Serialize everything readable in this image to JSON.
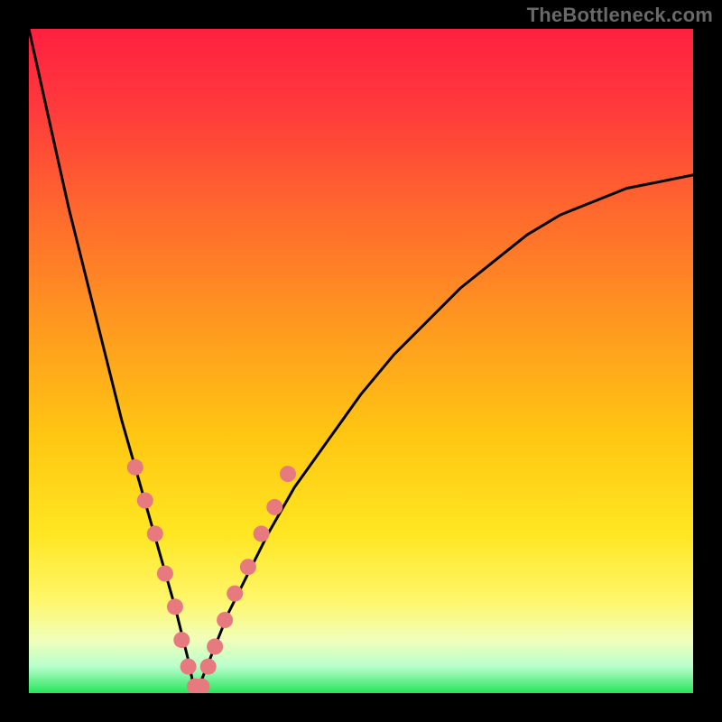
{
  "watermark": "TheBottleneck.com",
  "colors": {
    "gradient_stops": [
      {
        "offset": "0%",
        "color": "#ff2040"
      },
      {
        "offset": "12%",
        "color": "#ff3a3c"
      },
      {
        "offset": "28%",
        "color": "#ff6a2d"
      },
      {
        "offset": "45%",
        "color": "#ff9a1f"
      },
      {
        "offset": "62%",
        "color": "#ffc812"
      },
      {
        "offset": "76%",
        "color": "#ffe622"
      },
      {
        "offset": "86%",
        "color": "#fff66a"
      },
      {
        "offset": "92%",
        "color": "#f0ffba"
      },
      {
        "offset": "96%",
        "color": "#b8ffcc"
      },
      {
        "offset": "100%",
        "color": "#27e45a"
      }
    ],
    "curve_stroke": "#000000",
    "marker_fill": "#e77a7f",
    "frame": "#000000"
  },
  "chart_data": {
    "type": "line",
    "title": "",
    "xlabel": "",
    "ylabel": "",
    "xlim": [
      0,
      100
    ],
    "ylim": [
      0,
      100
    ],
    "x_min_at": 25,
    "left_top_y": 100,
    "right_end_y": 78,
    "note": "V-shaped bottleneck curve; y≈0 at x≈25, rising to ~100 at x=0 (left) and ~78 at x=100 (right). Pink markers cluster on lower portion of curve.",
    "series": [
      {
        "name": "curve",
        "x": [
          0,
          2,
          4,
          6,
          8,
          10,
          12,
          14,
          16,
          18,
          20,
          22,
          24,
          25,
          26,
          28,
          30,
          33,
          36,
          40,
          45,
          50,
          55,
          60,
          65,
          70,
          75,
          80,
          85,
          90,
          95,
          100
        ],
        "y": [
          100,
          91,
          82,
          73,
          65,
          57,
          49,
          41,
          34,
          27,
          20,
          13,
          5,
          0,
          2,
          7,
          12,
          18,
          24,
          31,
          38,
          45,
          51,
          56,
          61,
          65,
          69,
          72,
          74,
          76,
          77,
          78
        ]
      }
    ],
    "markers": {
      "color": "#e77a7f",
      "radius_px": 9,
      "points": [
        {
          "x": 16,
          "y": 34
        },
        {
          "x": 17.5,
          "y": 29
        },
        {
          "x": 19,
          "y": 24
        },
        {
          "x": 20.5,
          "y": 18
        },
        {
          "x": 22,
          "y": 13
        },
        {
          "x": 23,
          "y": 8
        },
        {
          "x": 24,
          "y": 4
        },
        {
          "x": 25,
          "y": 1
        },
        {
          "x": 26,
          "y": 1
        },
        {
          "x": 27,
          "y": 4
        },
        {
          "x": 28,
          "y": 7
        },
        {
          "x": 29.5,
          "y": 11
        },
        {
          "x": 31,
          "y": 15
        },
        {
          "x": 33,
          "y": 19
        },
        {
          "x": 35,
          "y": 24
        },
        {
          "x": 37,
          "y": 28
        },
        {
          "x": 39,
          "y": 33
        }
      ]
    }
  }
}
